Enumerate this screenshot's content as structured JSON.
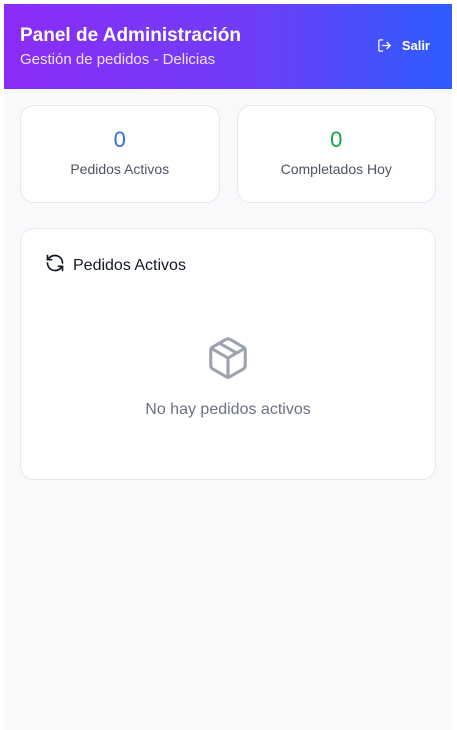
{
  "header": {
    "title": "Panel de Administración",
    "subtitle": "Gestión de pedidos - Delicias",
    "logout_label": "Salir"
  },
  "stats": [
    {
      "value": "0",
      "label": "Pedidos Activos",
      "color": "#2f6fe0"
    },
    {
      "value": "0",
      "label": "Completados Hoy",
      "color": "#16a34a"
    }
  ],
  "orders": {
    "title": "Pedidos Activos",
    "empty_message": "No hay pedidos activos"
  },
  "icons": {
    "logout": "logout-icon",
    "refresh": "refresh-icon",
    "empty": "package-icon"
  },
  "colors": {
    "gradient_start": "#8b2cf5",
    "gradient_end": "#2c5cff",
    "background": "#f8f9fb"
  }
}
